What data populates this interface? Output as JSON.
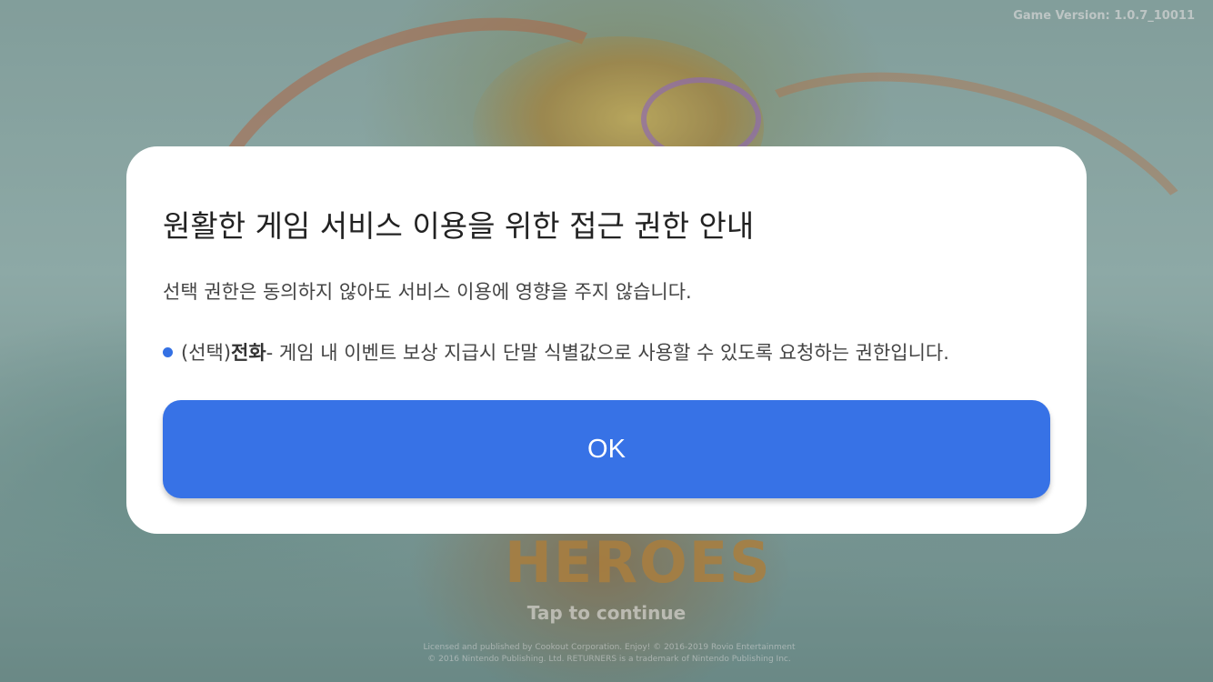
{
  "background": {
    "version_text": "Game Version: 1.0.7_10011",
    "logo_text": "HEROES",
    "tap_text": "Tap to continue",
    "copyright_line1": "Licensed and published by Cookout Corporation. Enjoy! © 2016-2019 Rovio Entertainment",
    "copyright_line2": "© 2016 Nintendo Publishing. Ltd. RETURNERS is a trademark of Nintendo Publishing Inc."
  },
  "dialog": {
    "title": "원활한 게임 서비스 이용을 위한 접근 권한 안내",
    "subtitle": "선택 권한은 동의하지 않아도 서비스 이용에 영향을 주지 않습니다.",
    "permissions": [
      {
        "prefix": "(선택)",
        "name": "전화",
        "description": " - 게임 내 이벤트 보상 지급시 단말 식별값으로 사용할 수 있도록 요청하는 권한입니다."
      }
    ],
    "ok_label": "OK"
  },
  "colors": {
    "accent": "#3772e6",
    "bullet": "#3471e4",
    "dialog_bg": "#ffffff"
  }
}
